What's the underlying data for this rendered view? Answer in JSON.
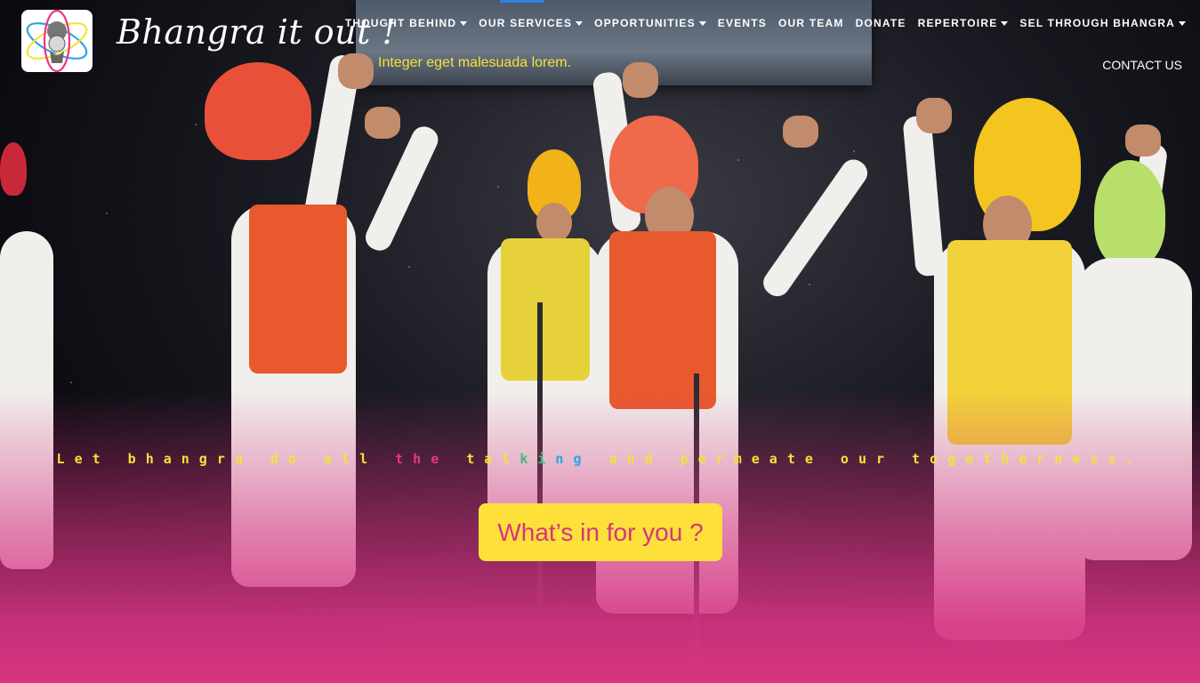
{
  "brand": {
    "logo_alt_icon": "bhangra-dancer-atom-logo",
    "name": "Bhangra it out !",
    "tagline": "Integer eget malesuada lorem."
  },
  "nav": {
    "items": [
      {
        "label": "THOUGHT BEHIND",
        "has_dropdown": true
      },
      {
        "label": "OUR SERVICES",
        "has_dropdown": true
      },
      {
        "label": "OPPORTUNITIES",
        "has_dropdown": true
      },
      {
        "label": "EVENTS",
        "has_dropdown": false
      },
      {
        "label": "OUR TEAM",
        "has_dropdown": false
      },
      {
        "label": "DONATE",
        "has_dropdown": false
      },
      {
        "label": "REPERTOIRE",
        "has_dropdown": true
      },
      {
        "label": "SEL THROUGH BHANGRA",
        "has_dropdown": true
      }
    ],
    "contact": "CONTACT US"
  },
  "hero": {
    "headline_parts": [
      {
        "text": "Let bhangra do all ",
        "color": "yellow"
      },
      {
        "text": "the ",
        "color": "pink"
      },
      {
        "text": "tal",
        "color": "yellow"
      },
      {
        "text": "ki",
        "color": "green"
      },
      {
        "text": "ng",
        "color": "blue"
      },
      {
        "text": " and permeate our togetherness.",
        "color": "yellow"
      }
    ],
    "cta_label": "What’s in for you ?"
  },
  "colors": {
    "accent_yellow": "#fde03a",
    "accent_pink": "#d6357f",
    "tagline_yellow": "#f3e33a"
  }
}
